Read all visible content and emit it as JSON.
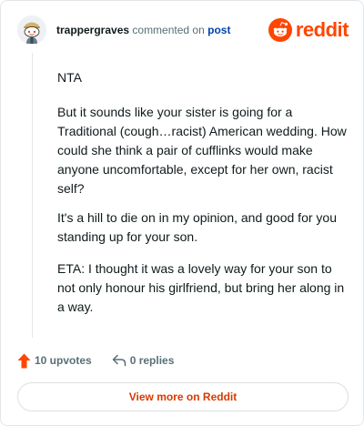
{
  "header": {
    "username": "trappergraves",
    "commented_on": "commented on",
    "post_link": "post",
    "brand": "reddit"
  },
  "comment": {
    "paragraphs": [
      "NTA",
      "But it sounds like your sister is going for a Traditional (cough…racist) American wedding. How could she think a pair of cufflinks would make anyone uncomfortable, except for her own, racist self?",
      "It's a hill to die on in my opinion, and good for you standing up for your son.",
      "ETA: I thought it was a lovely way for your son to not only honour his girlfriend, but bring her along in a way."
    ]
  },
  "actions": {
    "upvotes": "10 upvotes",
    "replies": "0 replies"
  },
  "footer": {
    "view_more": "View more on Reddit"
  },
  "colors": {
    "brand_orange": "#ff4500",
    "link_blue": "#0045ac",
    "view_more_text": "#d93a00",
    "muted_text": "#576f76"
  },
  "icons": {
    "avatar": "snoo-avatar",
    "brand": "reddit-logo-icon",
    "upvote": "upvote-arrow-icon",
    "reply": "reply-arrow-icon"
  }
}
